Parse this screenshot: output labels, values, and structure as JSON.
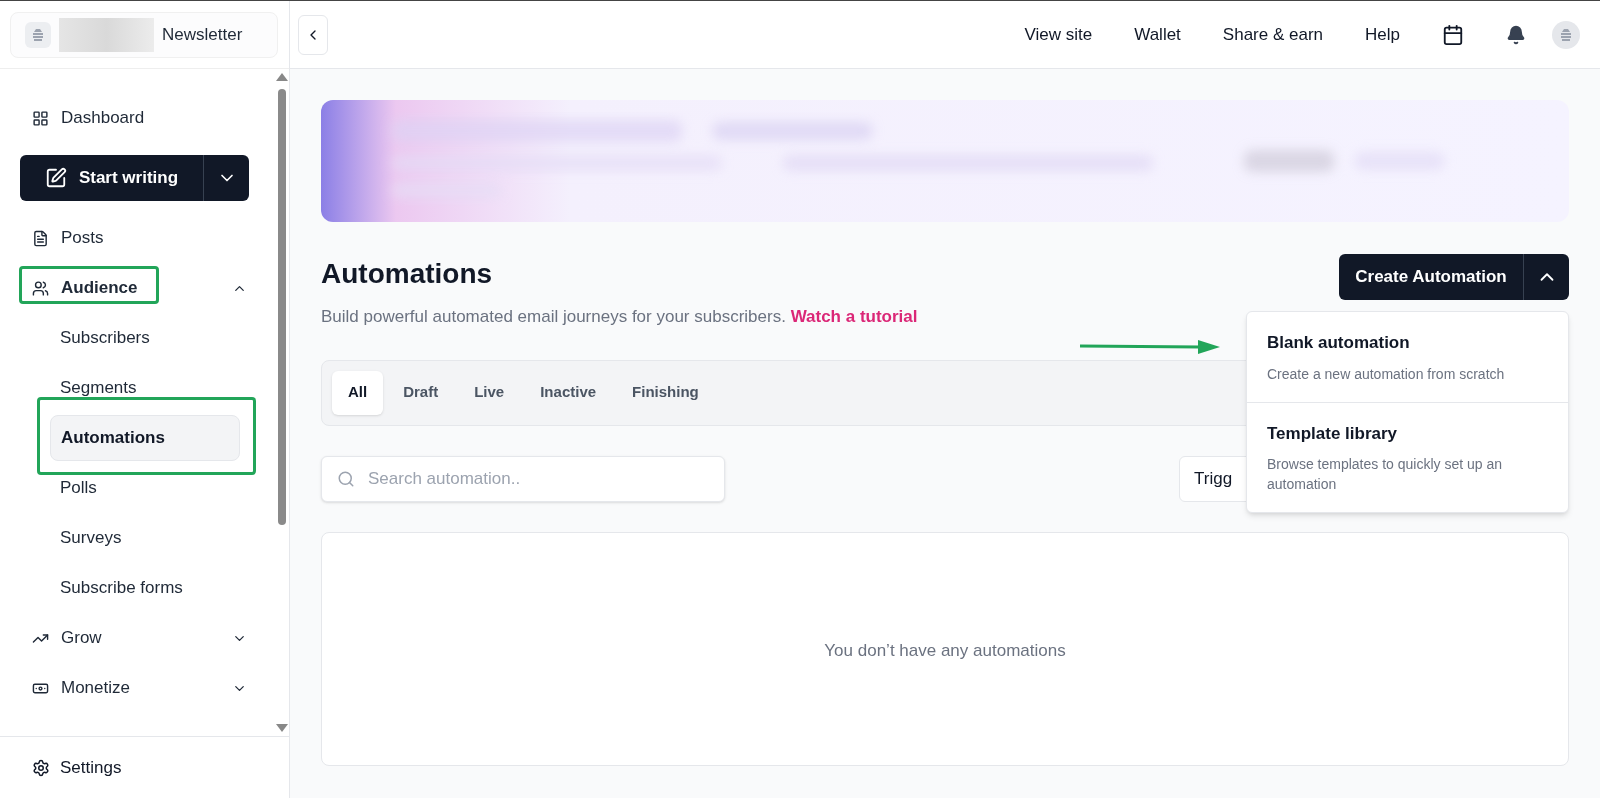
{
  "brand": {
    "name": "Newsletter"
  },
  "sidebar": {
    "items": [
      {
        "kind": "link",
        "label": "Dashboard"
      },
      {
        "kind": "action",
        "label": "Start writing"
      },
      {
        "kind": "link",
        "label": "Posts"
      },
      {
        "kind": "group",
        "label": "Audience",
        "expanded": true,
        "children": [
          {
            "label": "Subscribers",
            "selected": false
          },
          {
            "label": "Segments",
            "selected": false
          },
          {
            "label": "Automations",
            "selected": true
          },
          {
            "label": "Polls",
            "selected": false
          },
          {
            "label": "Surveys",
            "selected": false
          },
          {
            "label": "Subscribe forms",
            "selected": false
          }
        ]
      },
      {
        "kind": "group",
        "label": "Grow",
        "expanded": false
      },
      {
        "kind": "group",
        "label": "Monetize",
        "expanded": false
      }
    ],
    "footer": {
      "label": "Settings"
    }
  },
  "topbar": {
    "links": [
      "View site",
      "Wallet",
      "Share & earn",
      "Help"
    ]
  },
  "page": {
    "title": "Automations",
    "subtitle": "Build powerful automated email journeys for your subscribers.",
    "tutorial_link": "Watch a tutorial",
    "create_button": {
      "label": "Create Automation",
      "expanded": true
    },
    "menu": [
      {
        "title": "Blank automation",
        "description": "Create a new automation from scratch"
      },
      {
        "title": "Template library",
        "description": "Browse templates to quickly set up an automation"
      }
    ],
    "tabs": [
      {
        "label": "All",
        "selected": true
      },
      {
        "label": "Draft",
        "selected": false
      },
      {
        "label": "Live",
        "selected": false
      },
      {
        "label": "Inactive",
        "selected": false
      },
      {
        "label": "Finishing",
        "selected": false
      }
    ],
    "search": {
      "placeholder": "Search automation.."
    },
    "trigger_filter": {
      "label": "Trigg"
    },
    "empty_state": "You don’t have any automations"
  }
}
